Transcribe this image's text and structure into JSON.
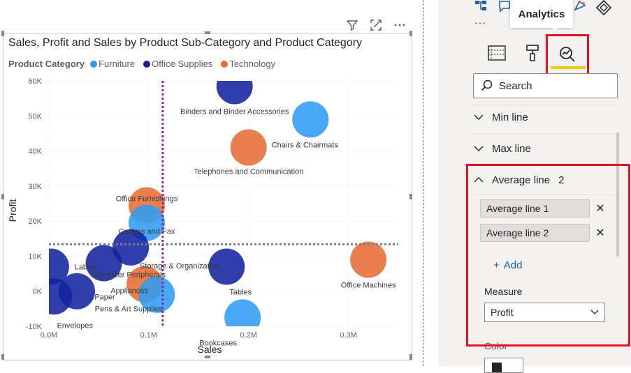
{
  "visual": {
    "title": "Sales, Profit and Sales by Product Sub-Category and Product Category",
    "legend_title": "Product Category",
    "legend": [
      {
        "label": "Furniture",
        "color": "#2f9cf4"
      },
      {
        "label": "Office Supplies",
        "color": "#12239e"
      },
      {
        "label": "Technology",
        "color": "#e66c37"
      }
    ],
    "toolbar": {
      "filter_icon": "filter-icon",
      "focus_icon": "focus-mode-icon",
      "more_icon": "more-options-icon"
    }
  },
  "chart_data": {
    "type": "scatter",
    "title": "Sales, Profit and Sales by Product Sub-Category and Product Category",
    "xlabel": "Sales",
    "ylabel": "Profit",
    "xlim": [
      0,
      0.35
    ],
    "ylim": [
      -10000,
      60000
    ],
    "x_ticks": [
      "0.0M",
      "0.1M",
      "0.2M",
      "0.3M"
    ],
    "y_ticks": [
      "-10K",
      "0K",
      "10K",
      "20K",
      "30K",
      "40K",
      "50K",
      "60K"
    ],
    "grid": true,
    "average_lines": {
      "x": 0.114,
      "y": 13400
    },
    "points": [
      {
        "label": "Binders and Binder Accessories",
        "category": "Office Supplies",
        "x": 0.186,
        "y": 58500
      },
      {
        "label": "Chairs & Chairmats",
        "category": "Furniture",
        "x": 0.262,
        "y": 49000
      },
      {
        "label": "Telephones and Communication",
        "category": "Technology",
        "x": 0.2,
        "y": 41000
      },
      {
        "label": "Office Furnishings",
        "category": "Technology",
        "x": 0.098,
        "y": 24500
      },
      {
        "label": "Copiers and Fax",
        "category": "Furniture",
        "x": 0.098,
        "y": 19500
      },
      {
        "label": "Storage & Organization",
        "category": "Office Supplies",
        "x": 0.082,
        "y": 12500
      },
      {
        "label": "Computer Peripherals",
        "category": "Office Supplies",
        "x": 0.055,
        "y": 8000
      },
      {
        "label": "Labels",
        "category": "Office Supplies",
        "x": 0.002,
        "y": 7000
      },
      {
        "label": "Tables",
        "category": "Office Supplies",
        "x": 0.178,
        "y": 7000
      },
      {
        "label": "Office Machines",
        "category": "Technology",
        "x": 0.32,
        "y": 9000
      },
      {
        "label": "Appliances",
        "category": "Technology",
        "x": 0.096,
        "y": 2000
      },
      {
        "label": "Paper",
        "category": "Office Supplies",
        "x": 0.028,
        "y": 0
      },
      {
        "label": "Pens & Art Supplies",
        "category": "Furniture",
        "x": 0.108,
        "y": -1000
      },
      {
        "label": "Envelopes",
        "category": "Office Supplies",
        "x": 0.005,
        "y": -1500
      },
      {
        "label": "Bookcases",
        "category": "Furniture",
        "x": 0.194,
        "y": -7500
      }
    ]
  },
  "pane": {
    "tooltip": "Analytics",
    "more": "···",
    "search_placeholder": "Search",
    "sections": {
      "min_line": "Min line",
      "max_line": "Max line",
      "average_line": "Average line",
      "average_count": "2"
    },
    "average_lines": [
      "Average line 1",
      "Average line 2"
    ],
    "add_label": "Add",
    "measure_label": "Measure",
    "measure_value": "Profit",
    "color_label": "Color"
  }
}
